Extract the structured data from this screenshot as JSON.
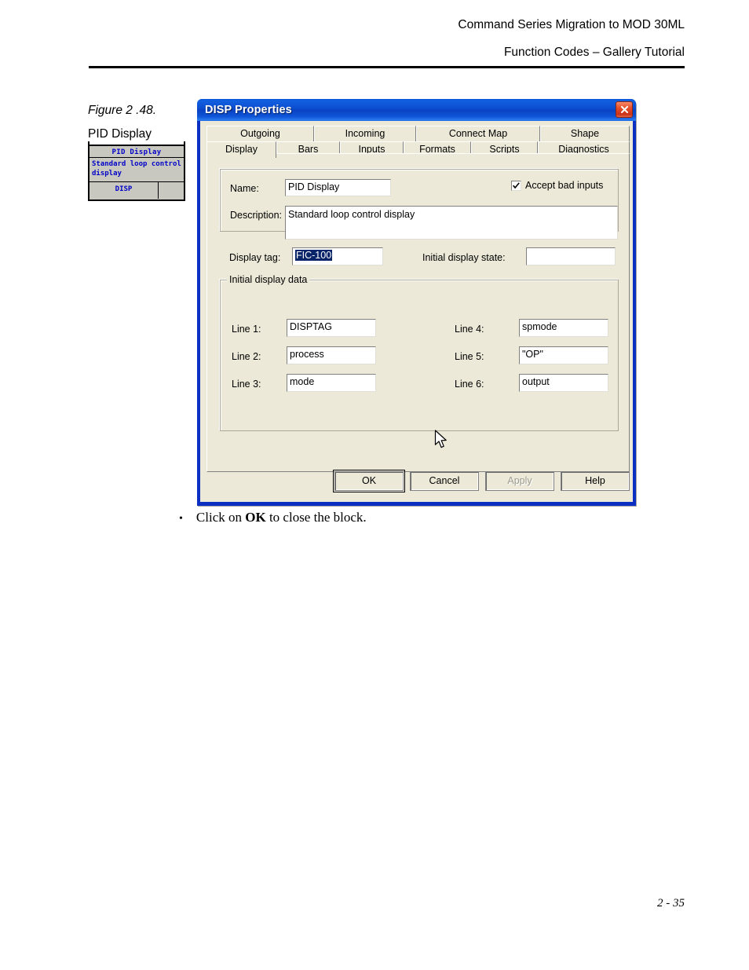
{
  "page": {
    "header_line1": "Command Series Migration to MOD 30ML",
    "header_line2": "Function Codes – Gallery Tutorial",
    "footer": "2 - 35"
  },
  "figure": {
    "number": "Figure 2 .48.",
    "title": "PID Display",
    "block": {
      "name": "PID Display",
      "description": "Standard loop control display",
      "type": "DISP"
    }
  },
  "dialog": {
    "title": "DISP Properties",
    "close_icon": "close-icon",
    "tabs_row1": [
      {
        "label": "Outgoing",
        "selected": false
      },
      {
        "label": "Incoming",
        "selected": false
      },
      {
        "label": "Connect Map",
        "selected": false
      },
      {
        "label": "Shape",
        "selected": false
      }
    ],
    "tabs_row2": [
      {
        "label": "Display",
        "selected": true
      },
      {
        "label": "Bars",
        "selected": false
      },
      {
        "label": "Inputs",
        "selected": false
      },
      {
        "label": "Formats",
        "selected": false
      },
      {
        "label": "Scripts",
        "selected": false
      },
      {
        "label": "Diagnostics",
        "selected": false
      }
    ],
    "fields": {
      "name_label": "Name:",
      "name_value": "PID Display",
      "description_label": "Description:",
      "description_value": "Standard loop control display",
      "accept_bad_inputs_label": "Accept bad inputs",
      "accept_bad_inputs_checked": true,
      "display_tag_label": "Display tag:",
      "display_tag_value": "FIC-100",
      "display_tag_selected": true,
      "initial_display_state_label": "Initial display state:",
      "initial_display_state_value": ""
    },
    "initial_display_data": {
      "legend": "Initial display data",
      "rows_left": [
        {
          "label": "Line 1:",
          "value": "DISPTAG"
        },
        {
          "label": "Line 2:",
          "value": "process"
        },
        {
          "label": "Line 3:",
          "value": "mode"
        }
      ],
      "rows_right": [
        {
          "label": "Line 4:",
          "value": "spmode"
        },
        {
          "label": "Line 5:",
          "value": "\"OP\""
        },
        {
          "label": "Line 6:",
          "value": "output"
        }
      ]
    },
    "buttons": [
      {
        "label": "OK",
        "state": "default"
      },
      {
        "label": "Cancel",
        "state": "normal"
      },
      {
        "label": "Apply",
        "state": "disabled"
      },
      {
        "label": "Help",
        "state": "normal"
      }
    ],
    "colors": {
      "titlebar_blue": "#0a43c4",
      "face": "#ece9d8",
      "selection_blue": "#0a246a",
      "close_red": "#e7502a"
    }
  },
  "instruction": {
    "bullet": "•",
    "prefix": "Click on ",
    "emphasis": "OK",
    "suffix": " to close the block."
  }
}
